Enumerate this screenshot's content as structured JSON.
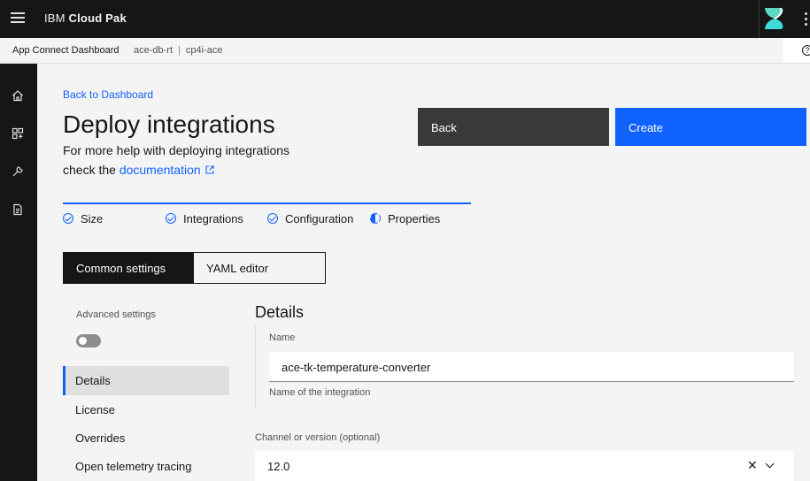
{
  "header": {
    "brand_prefix": "IBM",
    "brand_name": "Cloud Pak",
    "icons": [
      "menu-icon",
      "cloud-pak-logo",
      "overflow-menu-icon"
    ]
  },
  "subheader": {
    "app_name": "App Connect Dashboard",
    "instance": "ace-db-rt",
    "separator": "|",
    "namespace": "cp4i-ace",
    "help_icon": "?"
  },
  "rail": {
    "icons": [
      "home-icon",
      "integrations-icon",
      "tools-icon",
      "document-icon"
    ]
  },
  "page": {
    "back_link": "Back to Dashboard",
    "title": "Deploy integrations",
    "help_text_line1": "For more help with deploying integrations",
    "help_text_prefix": "check the",
    "doc_link": "documentation",
    "external_link_icon": "launch-icon"
  },
  "actions": {
    "back_label": "Back",
    "create_label": "Create"
  },
  "progress": {
    "steps": [
      {
        "label": "Size",
        "state": "complete"
      },
      {
        "label": "Integrations",
        "state": "complete"
      },
      {
        "label": "Configuration",
        "state": "complete"
      },
      {
        "label": "Properties",
        "state": "current"
      }
    ]
  },
  "switcher": {
    "common_label": "Common settings",
    "yaml_label": "YAML editor",
    "selected": "Common settings"
  },
  "settings_nav": {
    "advanced_label": "Advanced settings",
    "advanced_enabled": false,
    "items": [
      {
        "label": "Details",
        "active": true
      },
      {
        "label": "License",
        "active": false
      },
      {
        "label": "Overrides",
        "active": false
      },
      {
        "label": "Open telemetry tracing",
        "active": false
      }
    ]
  },
  "details": {
    "title": "Details",
    "name_label": "Name",
    "name_value": "ace-tk-temperature-converter",
    "name_helper": "Name of the integration",
    "channel_label": "Channel or version (optional)",
    "channel_value": "12.0",
    "clear_glyph": "✕"
  },
  "colors": {
    "primary": "#0f62fe",
    "header_bg": "#161616",
    "secondary_button": "#393939",
    "page_bg": "#f4f4f4"
  }
}
